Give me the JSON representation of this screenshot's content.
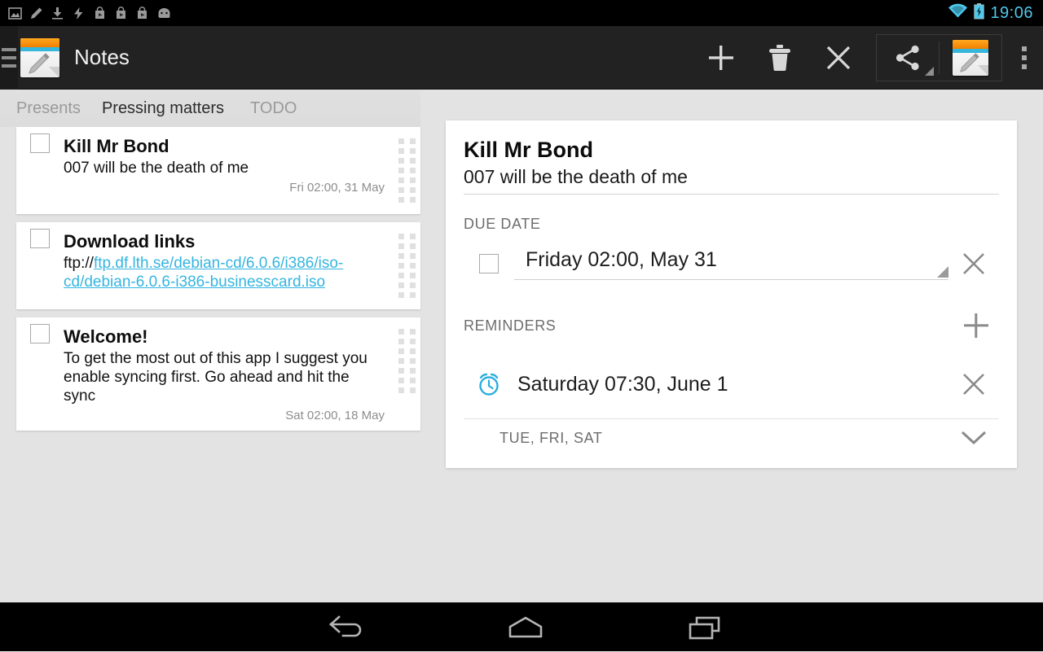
{
  "statusbar": {
    "time": "19:06",
    "left_icons": [
      "image-icon",
      "pencil-icon",
      "download-icon",
      "usb-icon",
      "playstore-icon",
      "playstore-icon",
      "playstore-icon",
      "android-icon"
    ],
    "right_icons": [
      "wifi-icon",
      "battery-charging-icon"
    ],
    "accent": "#4ec8ec"
  },
  "actionbar": {
    "app_title": "Notes",
    "up_icon": "drawer-icon",
    "app_icon": "notes-app-icon",
    "actions": [
      {
        "name": "add-note-button",
        "icon": "plus-icon"
      },
      {
        "name": "delete-note-button",
        "icon": "trash-icon"
      },
      {
        "name": "close-button",
        "icon": "close-icon"
      }
    ],
    "group": [
      {
        "name": "share-button",
        "icon": "share-icon"
      },
      {
        "name": "notes-app-button",
        "icon": "notes-app-icon"
      }
    ],
    "overflow_icon": "overflow-menu-icon"
  },
  "tabs": [
    {
      "label": "Presents",
      "active": false
    },
    {
      "label": "Pressing matters",
      "active": true
    },
    {
      "label": "TODO",
      "active": false
    }
  ],
  "notes": [
    {
      "title": "Kill Mr Bond",
      "desc": "007 will be the death of me",
      "link_prefix": "",
      "link": "",
      "date": "Fri 02:00, 31 May",
      "checked": false
    },
    {
      "title": "Download links",
      "desc": "ftp://",
      "link_prefix": "ftp://",
      "link": "ftp.df.lth.se/debian-cd/6.0.6/i386/iso-cd/debian-6.0.6-i386-businesscard.iso",
      "date": "",
      "checked": false
    },
    {
      "title": "Welcome!",
      "desc": "To get the most out of this app I suggest you enable syncing first. Go ahead and hit the sync",
      "link_prefix": "",
      "link": "",
      "date": "Sat 02:00, 18 May",
      "checked": false
    }
  ],
  "detail": {
    "title": "Kill Mr Bond",
    "subtitle": "007 will be the death of me",
    "due_label": "DUE DATE",
    "due_value": "Friday 02:00, May 31",
    "due_checked": false,
    "reminders_label": "REMINDERS",
    "reminder": {
      "icon": "alarm-clock-icon",
      "value": "Saturday 07:30, June 1",
      "accent": "#2aaedd"
    },
    "repeat_days": "TUE, FRI, SAT"
  },
  "navbar": {
    "back_icon": "back-icon",
    "home_icon": "home-icon",
    "recents_icon": "recents-icon"
  },
  "colors": {
    "background": "#e3e3e3",
    "card": "#ffffff",
    "accent_cyan": "#34b5e0",
    "actionbar": "#222222"
  }
}
